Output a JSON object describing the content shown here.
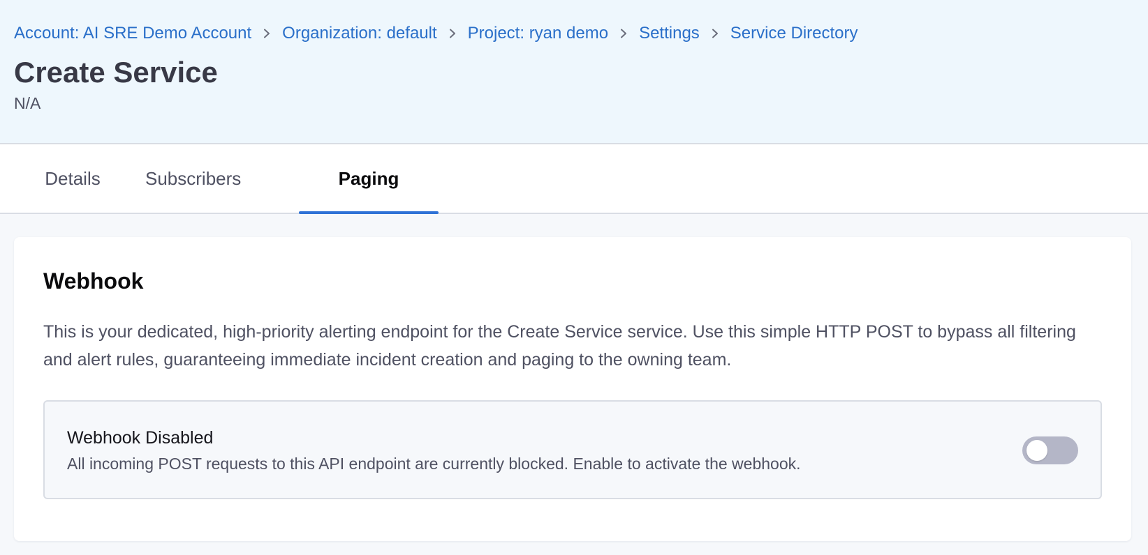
{
  "header": {
    "breadcrumbs": [
      {
        "label": "Account: AI SRE Demo Account"
      },
      {
        "label": "Organization: default"
      },
      {
        "label": "Project: ryan demo"
      },
      {
        "label": "Settings"
      },
      {
        "label": "Service Directory"
      }
    ],
    "breadcrumb_separator_icon": "chevron-right-icon",
    "title": "Create Service",
    "subtitle": "N/A"
  },
  "tabs": [
    {
      "label": "Details",
      "active": false
    },
    {
      "label": "Subscribers",
      "active": false
    },
    {
      "label": "Paging",
      "active": true
    }
  ],
  "webhook_card": {
    "title": "Webhook",
    "description": "This is your dedicated, high-priority alerting endpoint for the Create Service service. Use this simple HTTP POST to bypass all filtering and alert rules, guaranteeing immediate incident creation and paging to the owning team.",
    "status_title": "Webhook Disabled",
    "status_description": "All incoming POST requests to this API endpoint are currently blocked. Enable to activate the webhook.",
    "toggle_enabled": false
  },
  "colors": {
    "accent": "#2f72d6",
    "link": "#2a6fc9",
    "header_bg": "#eef7fd",
    "toggle_off": "#b4b6c7"
  }
}
